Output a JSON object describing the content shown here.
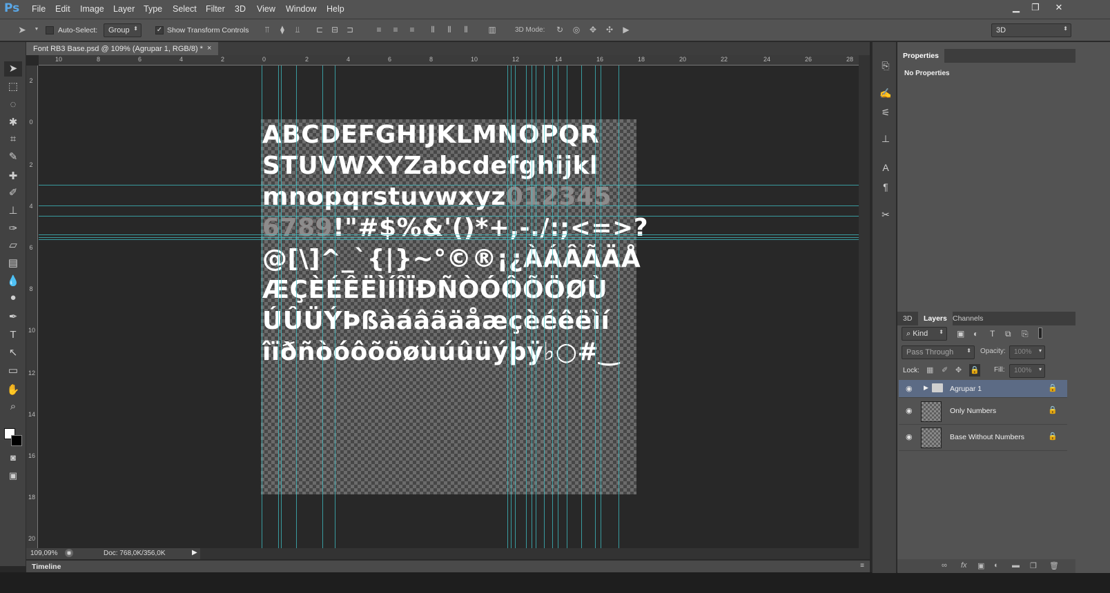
{
  "app": {
    "logo": "Ps"
  },
  "menu": [
    "File",
    "Edit",
    "Image",
    "Layer",
    "Type",
    "Select",
    "Filter",
    "3D",
    "View",
    "Window",
    "Help"
  ],
  "window_controls": {
    "minimize": "▁",
    "restore": "❐",
    "close": "✕"
  },
  "options": {
    "auto_select_label": "Auto-Select:",
    "auto_select_value": "Group",
    "show_transform_label": "Show Transform Controls",
    "mode_label": "3D Mode:",
    "workspace_value": "3D"
  },
  "document": {
    "tab_title": "Font RB3 Base.psd @ 109% (Agrupar 1, RGB/8) *",
    "close_glyph": "×",
    "glyphs": {
      "row1": "ABCDEFGHIJKLMNOPQR",
      "row2": "STUVWXYZabcdefghijkl",
      "row3a": "mnopqrstuvwxyz",
      "row3b": "012345",
      "row4a": "6789",
      "row4b": "!\"#$%&'()*+,-./:;<=>?",
      "row5": "@[\\]^_`{|}~°©®¡¿ÀÁÂÃÄÅ",
      "row6": "ÆÇÈÉÊËÌÍÎÏÐÑÒÓÔÕÖØÙ",
      "row7": "ÚÛÜÝÞßàáâãäåæçèéêëìí",
      "row8": "îïðñòóôõöøùúûüýþÿ♭○#‿"
    }
  },
  "ruler_h": [
    "10",
    "8",
    "6",
    "4",
    "2",
    "0",
    "2",
    "4",
    "6",
    "8",
    "10",
    "12",
    "14",
    "16",
    "18",
    "20",
    "22",
    "24",
    "26",
    "28"
  ],
  "ruler_v": [
    "2",
    "0",
    "2",
    "4",
    "6",
    "8",
    "10",
    "12",
    "14",
    "16",
    "18",
    "20"
  ],
  "status": {
    "zoom": "109,09%",
    "doc": "Doc: 768,0K/356,0K"
  },
  "timeline": {
    "label": "Timeline"
  },
  "properties": {
    "tab": "Properties",
    "text": "No Properties"
  },
  "layers_panel": {
    "tabs": [
      "3D",
      "Layers",
      "Channels"
    ],
    "kind_label": "Kind",
    "blend_mode": "Pass Through",
    "opacity_label": "Opacity:",
    "opacity_value": "100%",
    "lock_label": "Lock:",
    "fill_label": "Fill:",
    "fill_value": "100%",
    "layers": [
      {
        "name": "Agrupar 1",
        "type": "group",
        "selected": true
      },
      {
        "name": "Only Numbers",
        "type": "layer",
        "selected": false
      },
      {
        "name": "Base Without Numbers",
        "type": "layer",
        "selected": false
      }
    ]
  },
  "colors": {
    "guide": "#3fc3c8",
    "selection": "#5c6b85",
    "brand": "#5aa7e6"
  }
}
